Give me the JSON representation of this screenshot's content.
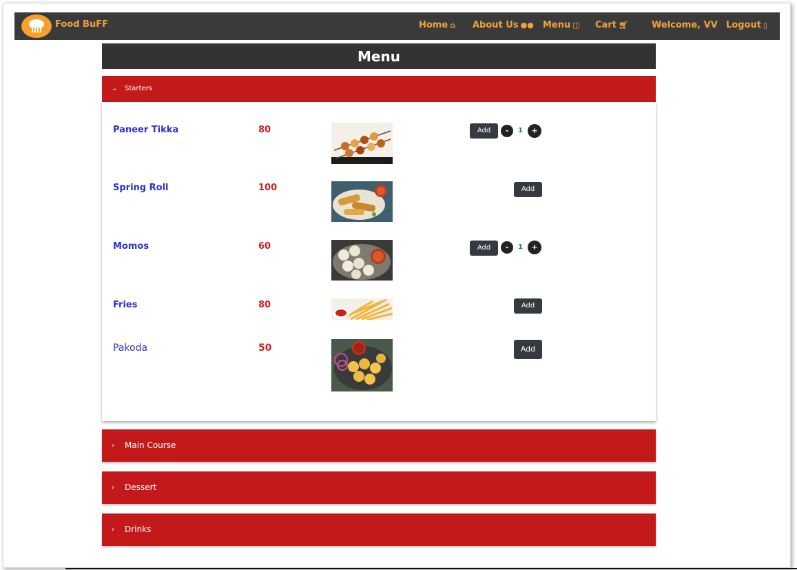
{
  "navbar": {
    "brand": "Food BuFF",
    "home": "Home",
    "about": "About Us",
    "menu": "Menu",
    "cart": "Cart",
    "welcome": "Welcome, VV",
    "logout": "Logout"
  },
  "page_title": "Menu",
  "categories": {
    "starters": "Starters",
    "main_course": "Main Course",
    "dessert": "Dessert",
    "drinks": "Drinks"
  },
  "items": [
    {
      "name": "Paneer Tikka",
      "price": "80",
      "add": "Add",
      "qty": "1",
      "minus": "-",
      "plus": "+"
    },
    {
      "name": "Spring Roll",
      "price": "100",
      "add": "Add"
    },
    {
      "name": "Momos",
      "price": "60",
      "add": "Add",
      "qty": "1",
      "minus": "-",
      "plus": "+"
    },
    {
      "name": "Fries",
      "price": "80",
      "add": "Add"
    },
    {
      "name": "Pakoda",
      "price": "50",
      "add": "Add"
    }
  ],
  "colors": {
    "navbar_bg": "#3a3a3a",
    "brand_orange": "#f0a33a",
    "accordion_red": "#c4191b",
    "title_bar_bg": "#333333",
    "item_name_blue": "#2f2fd6",
    "price_red": "#d01f1f"
  },
  "icons": {
    "logo": "chef-hat-logo",
    "home": "home-icon",
    "about": "about-dots-icon",
    "menu": "book-icon",
    "cart": "cart-icon",
    "logout": "door-icon",
    "expanded": "chevron-down-icon",
    "collapsed": "chevron-right-icon"
  }
}
